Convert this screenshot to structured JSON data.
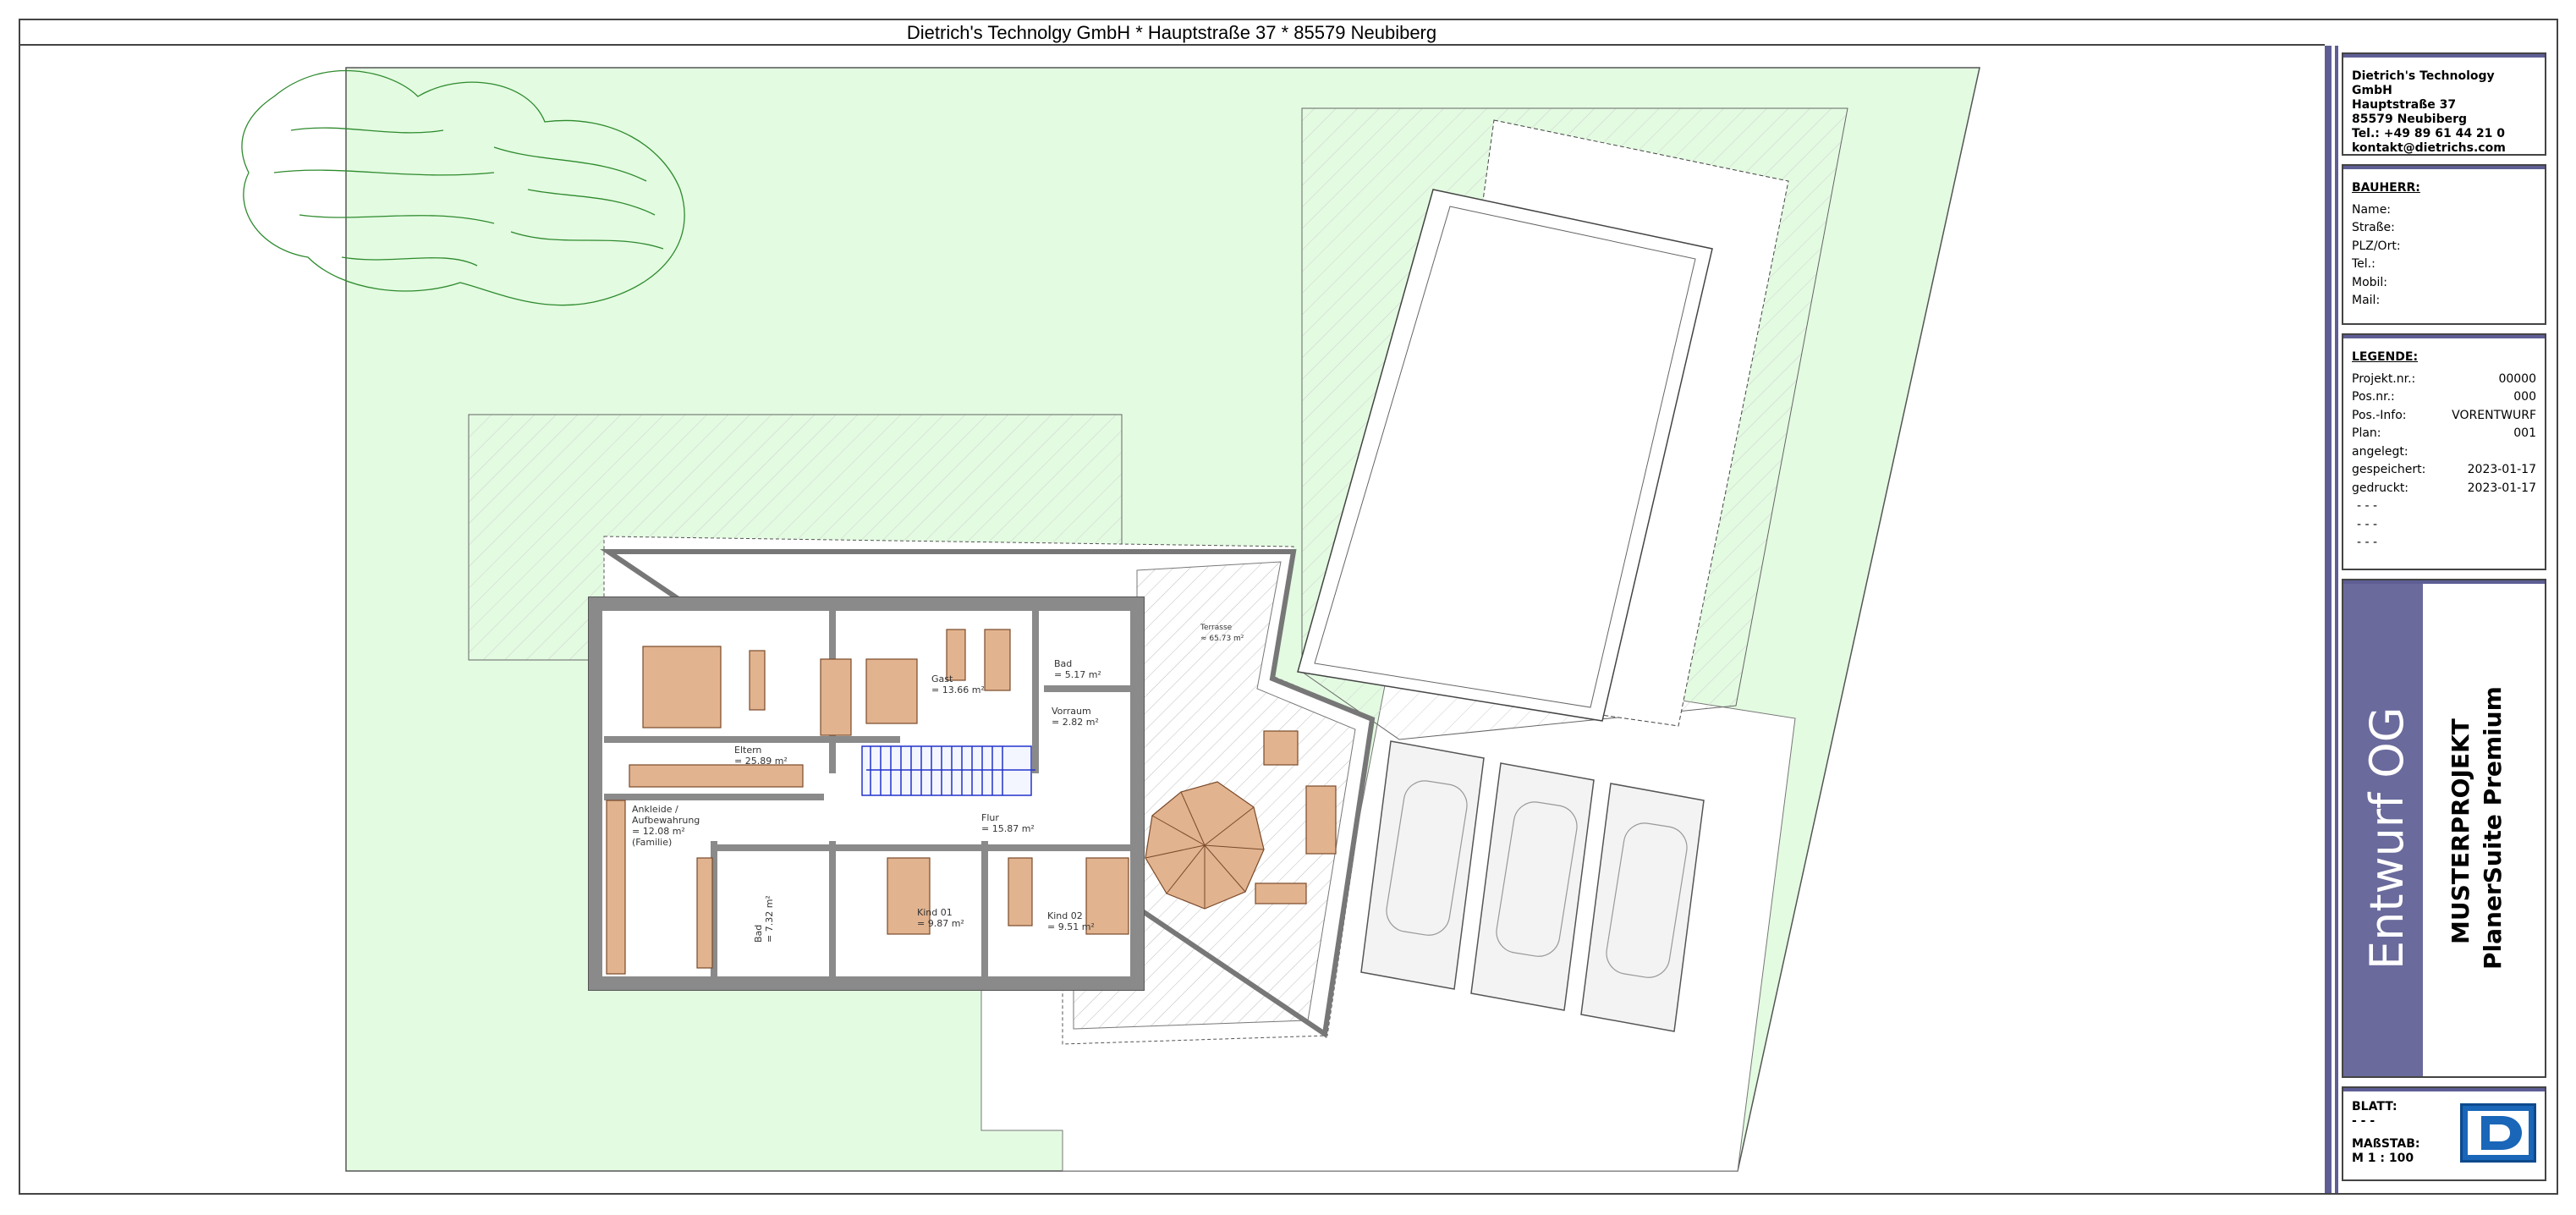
{
  "header": {
    "title": "Dietrich's Technolgy GmbH * Hauptstraße 37 * 85579 Neubiberg"
  },
  "rooms": {
    "eltern": {
      "name": "Eltern",
      "area": "= 25.89 m²"
    },
    "gast": {
      "name": "Gast",
      "area": "= 13.66 m²"
    },
    "bad_og": {
      "name": "Bad",
      "area": "= 5.17 m²"
    },
    "vorraum": {
      "name": "Vorraum",
      "area": "= 2.82 m²"
    },
    "terrasse": {
      "name": "Terrasse",
      "area": "≈ 65.73 m²"
    },
    "ankleide": {
      "name": "Ankleide /",
      "name2": "Aufbewahrung",
      "area": "= 12.08 m²",
      "note": "(Familie)"
    },
    "flur": {
      "name": "Flur",
      "area": "= 15.87 m²"
    },
    "bad2": {
      "name": "Bad",
      "area": "= 7.32 m²"
    },
    "kind01": {
      "name": "Kind 01",
      "area": "= 9.87 m²"
    },
    "kind02": {
      "name": "Kind 02",
      "area": "= 9.51 m²"
    }
  },
  "company": {
    "name": "Dietrich's Technology GmbH",
    "street": "Hauptstraße 37",
    "city": "85579 Neubiberg",
    "phone": "Tel.: +49 89 61 44 21 0",
    "email": "kontakt@dietrichs.com"
  },
  "bauherr": {
    "title": "BAUHERR:",
    "fields": [
      "Name:",
      "Straße:",
      "PLZ/Ort:",
      "Tel.:",
      "Mobil:",
      "Mail:"
    ]
  },
  "legende": {
    "title": "LEGENDE:",
    "rows": [
      {
        "label": "Projekt.nr.:",
        "value": "00000"
      },
      {
        "label": "Pos.nr.:",
        "value": "000"
      },
      {
        "label": "Pos.-Info:",
        "value": "VORENTWURF"
      },
      {
        "label": "Plan:",
        "value": "001"
      },
      {
        "label": "angelegt:",
        "value": ""
      },
      {
        "label": "gespeichert:",
        "value": "2023-01-17"
      },
      {
        "label": "gedruckt:",
        "value": "2023-01-17"
      }
    ],
    "dashes": [
      "- - -",
      "- - -",
      "- - -"
    ]
  },
  "plan_title": {
    "main": "Entwurf OG",
    "project": "MUSTERPROJEKT",
    "suite": "PlanerSuite Premium"
  },
  "blatt": {
    "label": "BLATT:",
    "value": "- - -",
    "scale_label": "MAßSTAB:",
    "scale_value": "M 1 : 100"
  },
  "colors": {
    "grass": "#e3fbe1",
    "wood": "#e2b38f",
    "wall": "#7a7a7a",
    "accent": "#5e5e95",
    "logo": "#1a66b8"
  }
}
